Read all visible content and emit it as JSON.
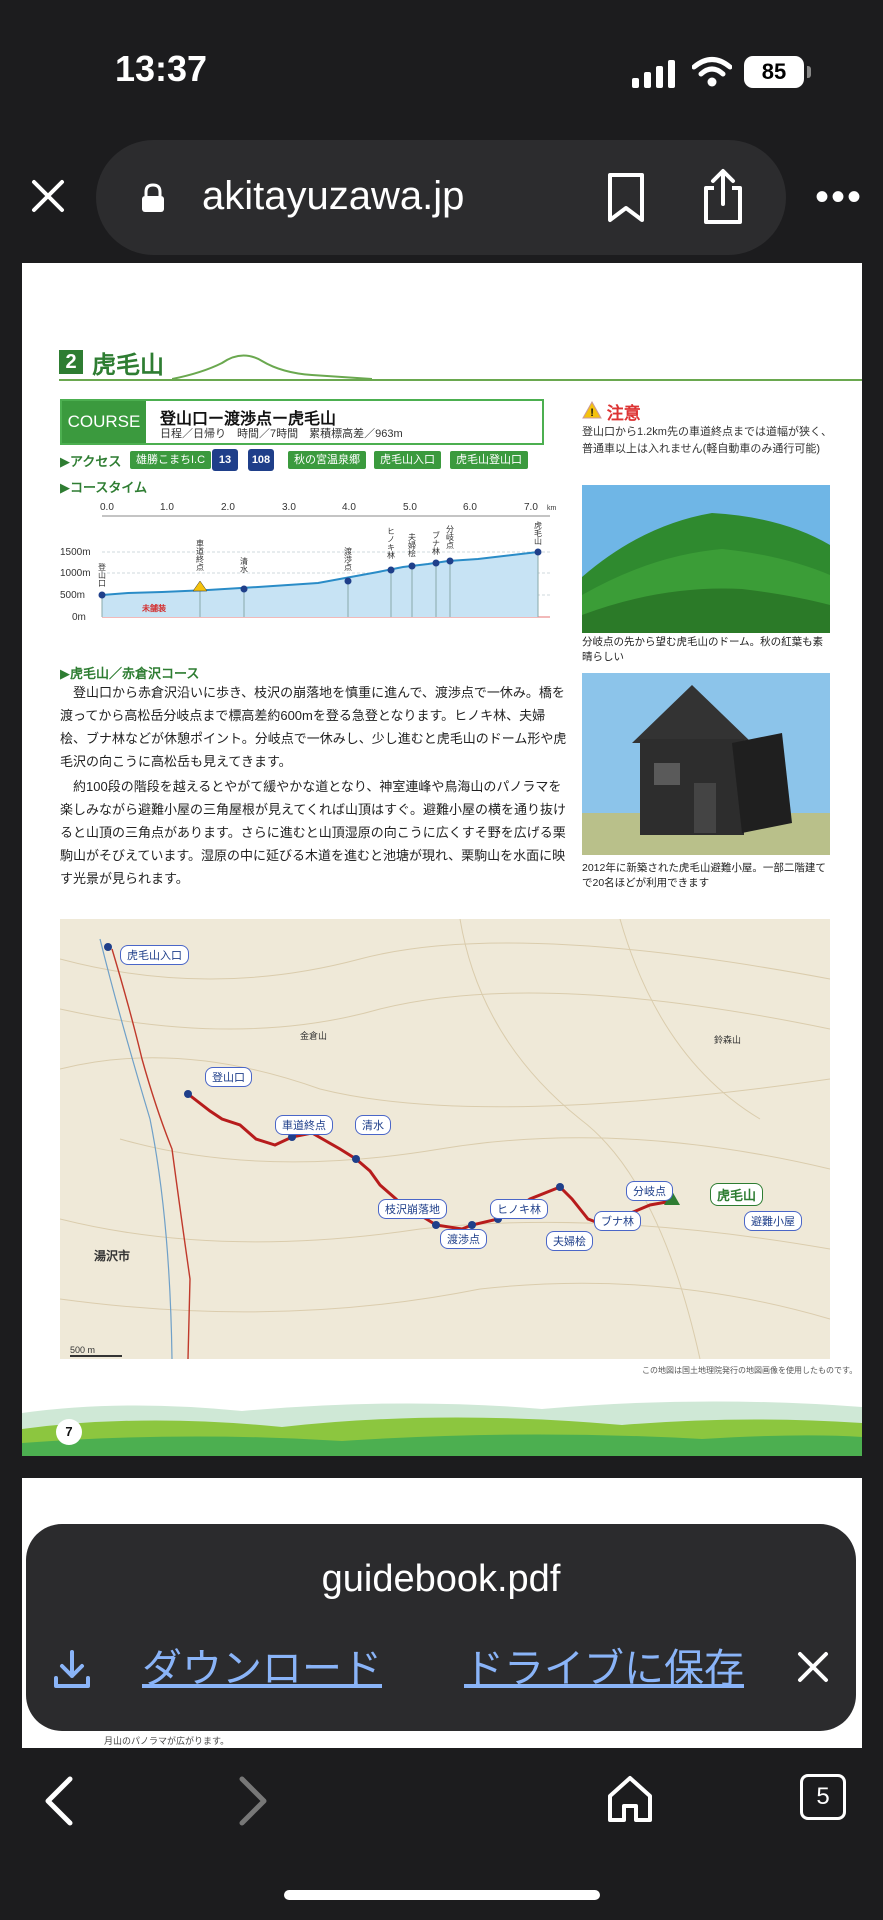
{
  "status_bar": {
    "time": "13:37",
    "battery": "85"
  },
  "browser": {
    "url": "akitayuzawa.jp"
  },
  "guide": {
    "section_number": "2",
    "section_title": "虎毛山",
    "course": {
      "label": "COURSE",
      "name": "登山口ー渡渉点ー虎毛山",
      "meta": "日程／日帰り　時間／7時間　累積標高差／963m"
    },
    "access": {
      "label": "▶アクセス",
      "items": [
        "雄勝こまちI.C",
        "13",
        "108",
        "秋の宮温泉郷",
        "虎毛山入口",
        "虎毛山登山口"
      ]
    },
    "course_time_label": "▶コースタイム",
    "profile": {
      "km_ticks": [
        "0.0",
        "1.0",
        "2.0",
        "3.0",
        "4.0",
        "5.0",
        "6.0",
        "7.0"
      ],
      "km_unit": "km",
      "elev_ticks": [
        "1500m",
        "1000m",
        "500m",
        "0m"
      ],
      "points": [
        "登山口",
        "車道終点",
        "清水",
        "渡渉点",
        "ヒノキ林",
        "夫婦桧",
        "ブナ林",
        "分岐点",
        "虎毛山"
      ],
      "unpaved": "未舗装"
    },
    "route_heading": "▶虎毛山／赤倉沢コース",
    "paragraphs": [
      "登山口から赤倉沢沿いに歩き、枝沢の崩落地を慎重に進んで、渡渉点で一休み。橋を渡ってから高松岳分岐点まで標高差約600mを登る急登となります。ヒノキ林、夫婦桧、ブナ林などが休憩ポイント。分岐点で一休みし、少し進むと虎毛山のドーム形や虎毛沢の向こうに高松岳も見えてきます。",
      "約100段の階段を越えるとやがて緩やかな道となり、神室連峰や鳥海山のパノラマを楽しみながら避難小屋の三角屋根が見えてくれば山頂はすぐ。避難小屋の横を通り抜けると山頂の三角点があります。さらに進むと山頂湿原の向こうに広くすそ野を広げる栗駒山がそびえています。湿原の中に延びる木道を進むと池塘が現れ、栗駒山を水面に映す光景が見られます。"
    ],
    "warning": {
      "title": "注意",
      "text": "登山口から1.2km先の車道終点までは道幅が狭く、普通車以上は入れません(軽自動車のみ通行可能)"
    },
    "photo_captions": [
      "分岐点の先から望む虎毛山のドーム。秋の紅葉も素晴らしい",
      "2012年に新築された虎毛山避難小屋。一部二階建てで20名ほどが利用できます"
    ],
    "map": {
      "labels": [
        "虎毛山入口",
        "登山口",
        "車道終点",
        "清水",
        "枝沢崩落地",
        "渡渉点",
        "ヒノキ林",
        "夫婦桧",
        "ブナ林",
        "分岐点",
        "虎毛山",
        "避難小屋"
      ],
      "place": "湯沢市",
      "other_places": [
        "金倉山",
        "鈴森山"
      ],
      "scale": "500 m",
      "credit": "この地図は国土地理院発行の地図画像を使用したものです。"
    },
    "page_number": "7",
    "next_page_snippet": "月山のパノラマが広がります。"
  },
  "download": {
    "filename": "guidebook.pdf",
    "download_label": "ダウンロード",
    "drive_label": "ドライブに保存"
  },
  "toolbar": {
    "tab_count": "5"
  }
}
